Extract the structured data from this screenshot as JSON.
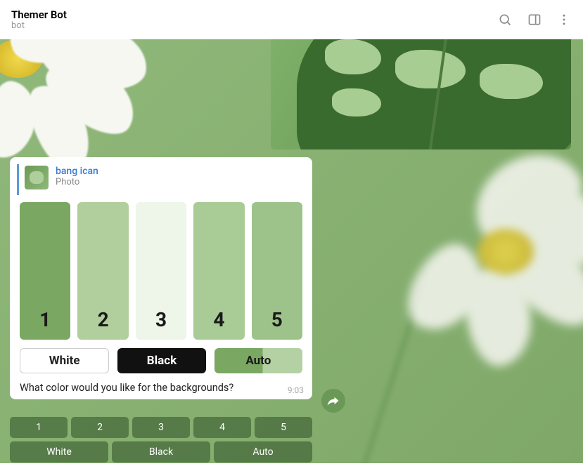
{
  "header": {
    "title": "Themer Bot",
    "subtitle": "bot"
  },
  "message": {
    "reply": {
      "name": "bang ican",
      "type": "Photo"
    },
    "swatches": [
      {
        "label": "1",
        "color": "#7aa862"
      },
      {
        "label": "2",
        "color": "#b0cf9c"
      },
      {
        "label": "3",
        "color": "#eef5e9"
      },
      {
        "label": "4",
        "color": "#a9cb96"
      },
      {
        "label": "5",
        "color": "#9dc38b"
      }
    ],
    "options": {
      "white": "White",
      "black": "Black",
      "auto": "Auto"
    },
    "text": "What color would you like for the backgrounds?",
    "time": "9:03"
  },
  "keyboard": {
    "row1": [
      "1",
      "2",
      "3",
      "4",
      "5"
    ],
    "row2": [
      "White",
      "Black",
      "Auto"
    ]
  }
}
